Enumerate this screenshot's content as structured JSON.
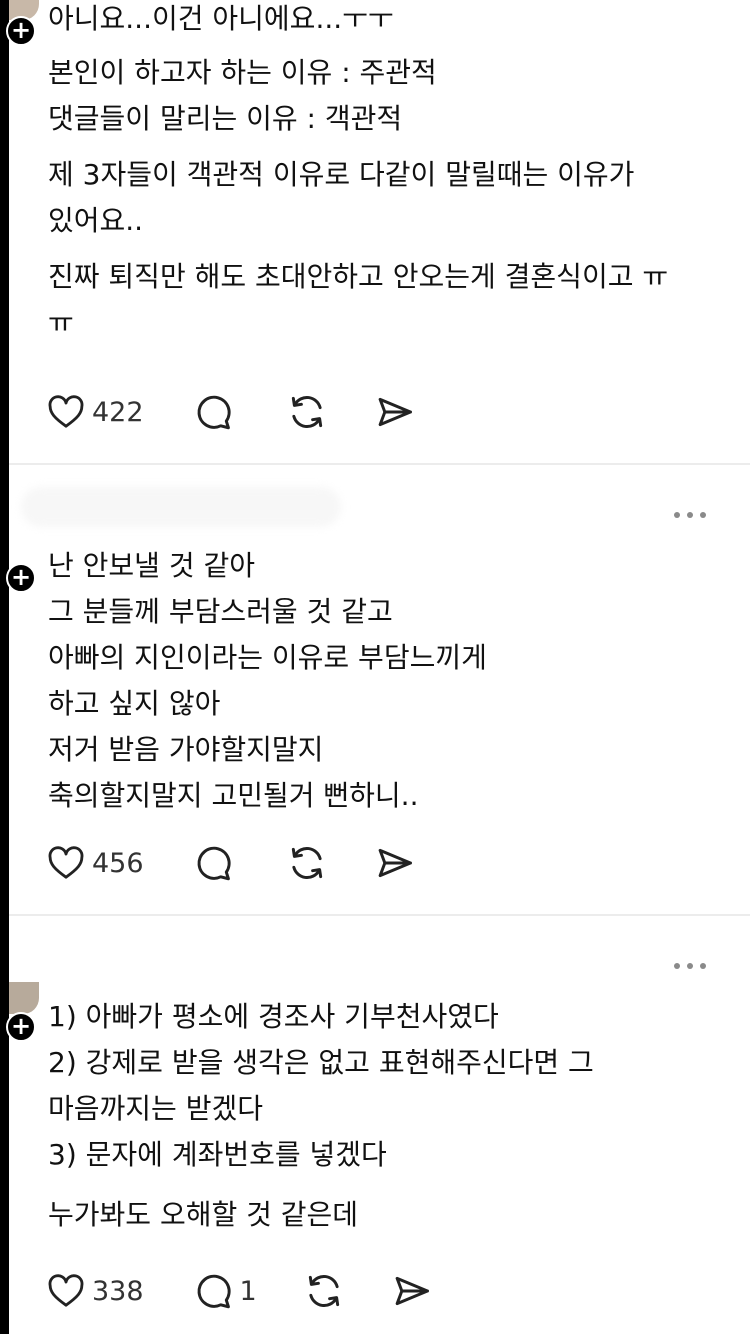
{
  "posts": [
    {
      "paragraphs": [
        [
          "아니요...이건 아니에요...ㅜㅜ"
        ],
        [
          "본인이 하고자 하는 이유 : 주관적",
          "댓글들이 말리는 이유 : 객관적"
        ],
        [
          "제 3자들이 객관적 이유로 다같이 말릴때는 이유가",
          "있어요.."
        ],
        [
          "진짜 퇴직만 해도 초대안하고 안오는게 결혼식이고 ㅠ",
          "ㅠ"
        ]
      ],
      "likes": "422",
      "comments": ""
    },
    {
      "paragraphs": [
        [
          "난 안보낼 것 같아",
          "그 분들께 부담스러울 것 같고",
          "아빠의 지인이라는 이유로 부담느끼게",
          "하고 싶지 않아",
          "저거 받음 가야할지말지",
          "축의할지말지 고민될거 뻔하니.."
        ]
      ],
      "likes": "456",
      "comments": ""
    },
    {
      "paragraphs": [
        [
          "1) 아빠가 평소에 경조사 기부천사였다",
          "2) 강제로 받을 생각은 없고 표현해주신다면 그",
          "마음까지는 받겠다",
          "3) 문자에 계좌번호를 넣겠다"
        ],
        [
          "누가봐도 오해할 것 같은데"
        ]
      ],
      "likes": "338",
      "comments": "1"
    }
  ],
  "icons": {
    "like": "heart-icon",
    "comment": "speech-bubble-icon",
    "repost": "repost-icon",
    "share": "send-icon",
    "more": "more-icon",
    "follow": "plus-icon"
  },
  "colors": {
    "text": "#111111",
    "icon": "#222222",
    "divider": "#ececec",
    "muted": "#8a8a8a"
  }
}
